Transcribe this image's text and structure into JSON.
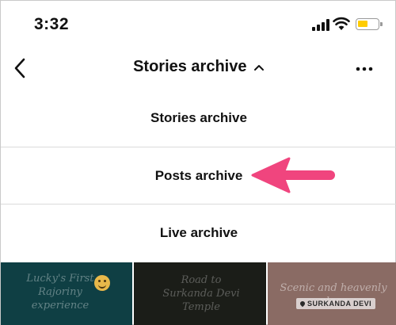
{
  "status_bar": {
    "time": "3:32",
    "battery_color": "#ffcc00"
  },
  "header": {
    "title": "Stories archive",
    "back_icon": "chevron-left-icon",
    "caret_icon": "chevron-up-icon",
    "more_icon": "more-horizontal-icon"
  },
  "archive_menu": {
    "items": [
      {
        "label": "Stories archive"
      },
      {
        "label": "Posts archive"
      },
      {
        "label": "Live archive"
      }
    ]
  },
  "annotation": {
    "arrow_color": "#f0457e"
  },
  "thumbnails": [
    {
      "caption": "Lucky's First\nRajoriny experience"
    },
    {
      "caption": "Road to\nSurkanda Devi Temple"
    },
    {
      "caption": "Scenic and heavenly place",
      "location": "SURKANDA DEVI"
    }
  ]
}
